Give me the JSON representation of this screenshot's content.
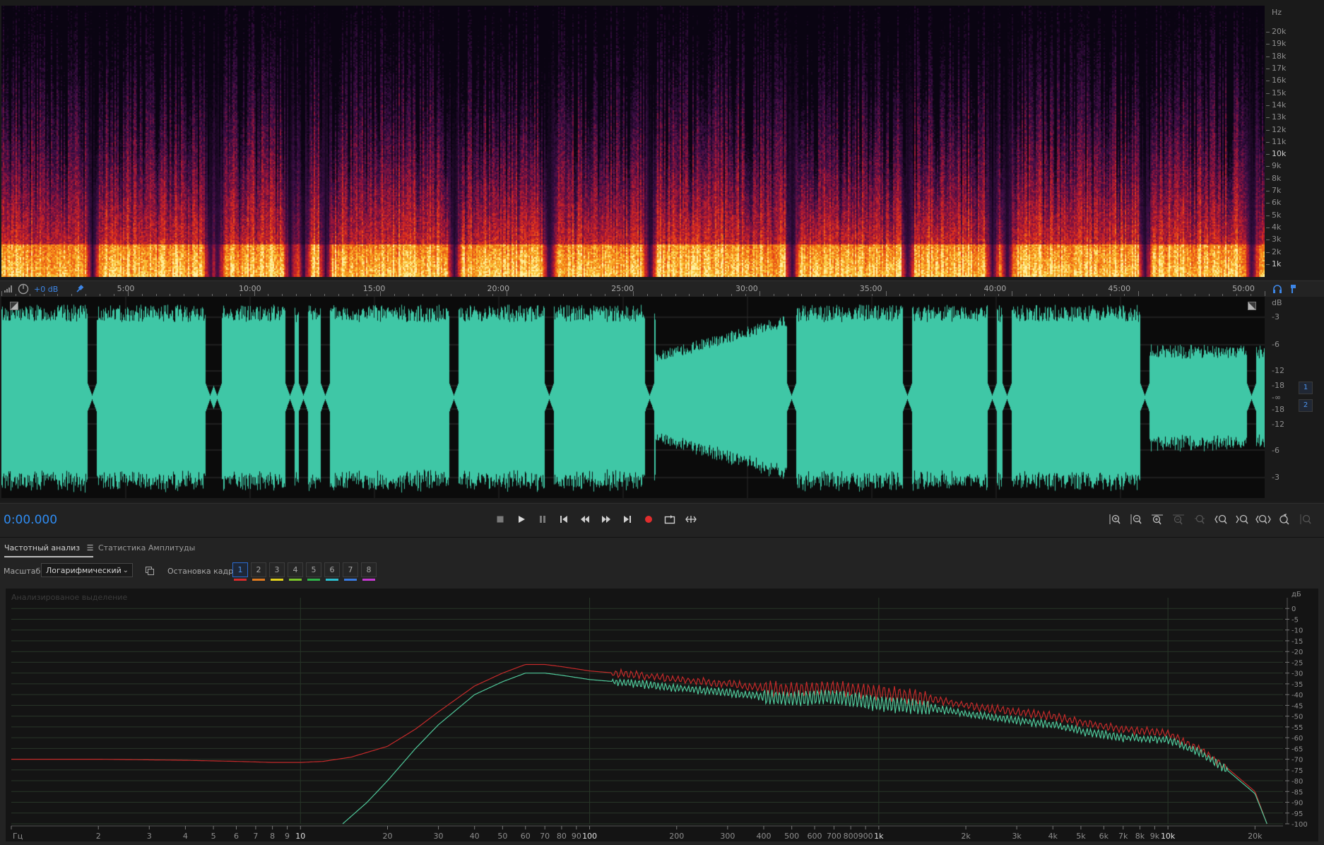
{
  "spectral": {
    "unit": "Hz",
    "ticks": [
      "20k",
      "19k",
      "18k",
      "17k",
      "16k",
      "15k",
      "14k",
      "13k",
      "12k",
      "11k",
      "10k",
      "9k",
      "8k",
      "7k",
      "6k",
      "5k",
      "4k",
      "3k",
      "2k",
      "1k"
    ]
  },
  "timeline": {
    "gain": "+0 dB",
    "labels": [
      "5:00",
      "10:00",
      "15:00",
      "20:00",
      "25:00",
      "30:00",
      "35:00",
      "40:00",
      "45:00",
      "50:00"
    ]
  },
  "waveform": {
    "unit": "dB",
    "ticks_top": [
      "-3",
      "-6",
      "-12",
      "-18"
    ],
    "center": "-∞",
    "ticks_bottom": [
      "-18",
      "-12",
      "-6",
      "-3"
    ],
    "channels": [
      "1",
      "2"
    ],
    "wave_color": "#3fc7a6"
  },
  "transport": {
    "time": "0:00.000"
  },
  "panel": {
    "tabs": [
      {
        "label": "Частотный анализ",
        "active": true
      },
      {
        "label": "Статистика Амплитуды",
        "active": false
      }
    ],
    "scale_label": "Масштаб:",
    "scale_value": "Логарифмический",
    "freeze_label": "Остановка кадра:",
    "slots": [
      {
        "n": "1",
        "color": "#d62b2b"
      },
      {
        "n": "2",
        "color": "#e07a1f"
      },
      {
        "n": "3",
        "color": "#e3d21c"
      },
      {
        "n": "4",
        "color": "#7bc52a"
      },
      {
        "n": "5",
        "color": "#2fb34a"
      },
      {
        "n": "6",
        "color": "#2dbfcf"
      },
      {
        "n": "7",
        "color": "#3a7be0"
      },
      {
        "n": "8",
        "color": "#c43ad0"
      }
    ],
    "analyzed_label": "Анализированое выделение"
  },
  "chart_data": {
    "type": "line",
    "xlabel": "Гц",
    "ylabel": "дБ",
    "x_scale": "log",
    "xlim": [
      1,
      25000
    ],
    "ylim": [
      -100,
      5
    ],
    "x_ticks": [
      "Гц",
      "2",
      "3",
      "4",
      "5",
      "6",
      "7",
      "8",
      "9",
      "10",
      "20",
      "30",
      "40",
      "50",
      "60",
      "70",
      "80",
      "90",
      "100",
      "200",
      "300",
      "400",
      "500",
      "600",
      "700",
      "800",
      "900",
      "1k",
      "2k",
      "3k",
      "4k",
      "5k",
      "6k",
      "7k",
      "8k",
      "9k",
      "10k",
      "20k"
    ],
    "y_ticks": [
      "дБ",
      "0",
      "-5",
      "-10",
      "-15",
      "-20",
      "-25",
      "-30",
      "-35",
      "-40",
      "-45",
      "-50",
      "-55",
      "-60",
      "-65",
      "-70",
      "-75",
      "-80",
      "-85",
      "-90",
      "-95",
      "-100"
    ],
    "series": [
      {
        "color": "#c42a2a",
        "x": [
          1,
          2,
          4,
          6,
          8,
          10,
          12,
          15,
          20,
          25,
          30,
          40,
          50,
          60,
          70,
          80,
          100,
          150,
          200,
          300,
          400,
          500,
          700,
          1000,
          1500,
          2000,
          3000,
          4000,
          5000,
          7000,
          10000,
          13000,
          16000,
          20000,
          22000
        ],
        "y": [
          -70,
          -70,
          -70.5,
          -71,
          -71.5,
          -71.5,
          -71,
          -69,
          -64,
          -56,
          -48,
          -36,
          -30,
          -26,
          -26,
          -27,
          -29,
          -31,
          -33,
          -35,
          -37,
          -38,
          -37,
          -39,
          -42,
          -45,
          -48,
          -50,
          -53,
          -56,
          -58,
          -66,
          -74,
          -85,
          -100
        ]
      },
      {
        "color": "#4fc89a",
        "x": [
          14,
          17,
          20,
          25,
          30,
          40,
          50,
          60,
          70,
          80,
          100,
          150,
          200,
          300,
          400,
          500,
          700,
          1000,
          1500,
          2000,
          3000,
          4000,
          5000,
          7000,
          10000,
          13000,
          16000,
          20000,
          22000
        ],
        "y": [
          -100,
          -90,
          -80,
          -65,
          -54,
          -40,
          -34,
          -30,
          -30,
          -31,
          -33,
          -35,
          -37,
          -39,
          -41,
          -42,
          -41,
          -44,
          -46,
          -49,
          -52,
          -54,
          -57,
          -60,
          -61,
          -67,
          -75,
          -86,
          -100
        ]
      }
    ]
  }
}
